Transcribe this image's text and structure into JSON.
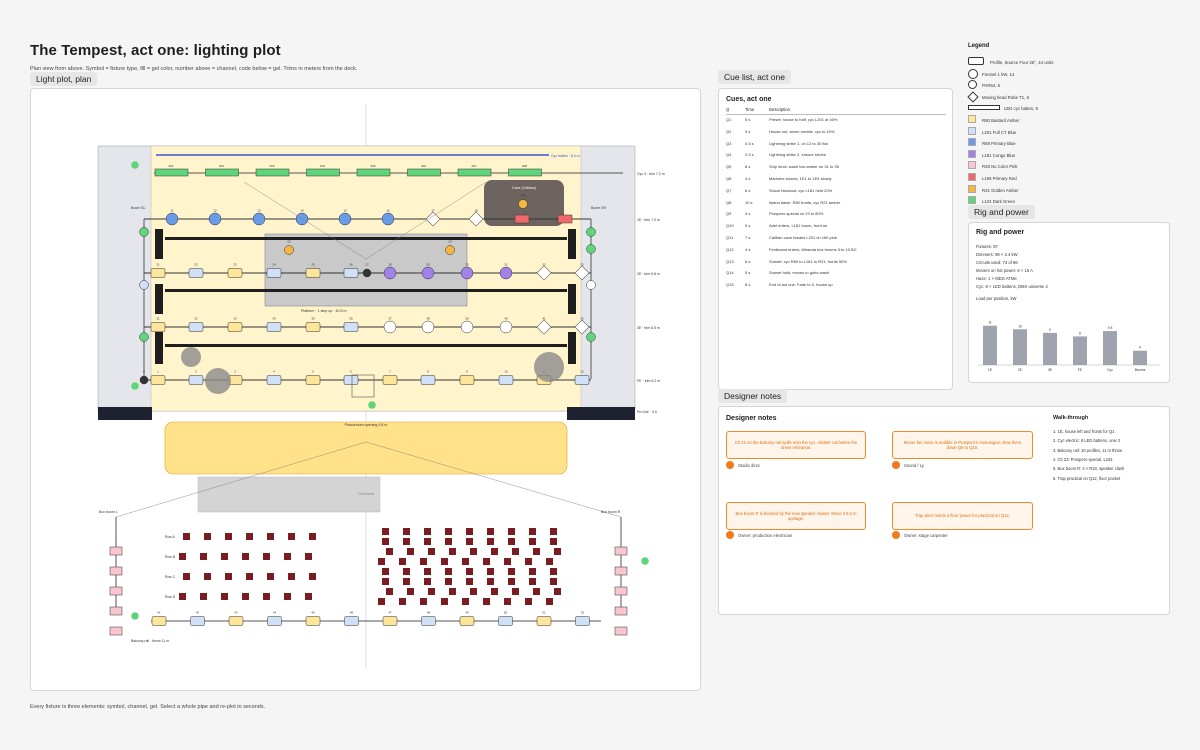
{
  "page": {
    "title": "The Tempest, act one: lighting plot",
    "subtitle": "Plan view from above. Symbol = fixture type, fill = gel color, number above = channel, code below = gel. Trims in meters from the deck.",
    "footer": "Every fixture is three elements: symbol, channel, gel. Select a whole pipe and re-plot in seconds."
  },
  "plot": {
    "label": "Light plot, plan",
    "cyc_label": "Cyc 3 · trim 7.2 m",
    "cyc_strip_label": "Cyc batten · 8.4 m",
    "boom_left": "Boom SL",
    "boom_right": "Boom SR",
    "electrics": [
      "1E · trim 7.0 m",
      "2E · trim 6.8 m",
      "3E · trim 6.5 m",
      "FE · trim 6.2 m"
    ],
    "platform_label": "Platform · 1 step up · 40.5 m",
    "cave_label": "Cave (Caliban)",
    "proscenium_label": "Proscenium opening 9.8 m",
    "proscenium_right": "Pro line · 0.0",
    "apron_label": "Orchestra",
    "box_left": "Box boom L",
    "box_right": "Box boom R",
    "rows": [
      "Row A",
      "Row B",
      "Row C",
      "Row D"
    ],
    "balcony_label": "Balcony rail · throw 11 m",
    "gel_marks": "R80 · L201 · R69 · L181"
  },
  "cues": {
    "tab": "Cue list, act one",
    "heading": "Cues, act one",
    "columns": [
      "Q",
      "Time",
      "Description"
    ],
    "rows": [
      [
        "Q1",
        "5 s",
        "Preset: house to half, cyc L201 at 40%"
      ],
      [
        "Q2",
        "3 s",
        "House out, storm rumble, cyc to 10%"
      ],
      [
        "Q3",
        "0.5 s",
        "Lightning strike 1, ch 12 to 30 flat"
      ],
      [
        "Q4",
        "0.3 s",
        "Lightning strike 2, ensure strobe"
      ],
      [
        "Q5",
        "8 s",
        "Ship deck: wash low amber on 31 to 35"
      ],
      [
        "Q6",
        "4 s",
        "Mariners shouts, 1E1 to 1E4 slowly"
      ],
      [
        "Q7",
        "6 s",
        "Shock blackout, cyc L181 held 20%"
      ],
      [
        "Q8",
        "10 s",
        "Island dawn: R80 fronts, cyc R21 amber"
      ],
      [
        "Q9",
        "3 s",
        "Prospero special ch 23 to 80%"
      ],
      [
        "Q10",
        "5 s",
        "Ariel enters, L181 boom, front on"
      ],
      [
        "Q11",
        "7 s",
        "Caliban cave breaks L201 ch 160 pink"
      ],
      [
        "Q12",
        "4 s",
        "Ferdinand enters, Miranda box booms 3 to 10 BC"
      ],
      [
        "Q13",
        "6 s",
        "Sunset: cyc R80 to L181 to R21, fronts 50%"
      ],
      [
        "Q14",
        "5 s",
        "Sunset hold, moves to gobo wash"
      ],
      [
        "Q15",
        "8 s",
        "End of act one. Fade to 0, house up"
      ]
    ]
  },
  "legend": {
    "title": "Legend",
    "items": [
      {
        "label": "Profile, Source Four 26°, 44 units",
        "shape": "profile",
        "color": "#ffffff"
      },
      {
        "label": "Fresnel 1 kW, 14",
        "shape": "circle",
        "color": "#ffffff"
      },
      {
        "label": "PAR64, 6",
        "shape": "circle-small",
        "color": "#ffffff"
      },
      {
        "label": "Moving head Robe T1, 6",
        "shape": "diamond",
        "color": "#ffffff"
      },
      {
        "label": "LED cyc batten, 8",
        "shape": "batten",
        "color": "#ffffff"
      },
      {
        "label": "R80 Bastard Amber",
        "shape": "swatch",
        "color": "#fde59a"
      },
      {
        "label": "L201 Full CT Blue",
        "shape": "swatch",
        "color": "#cfe0f7"
      },
      {
        "label": "R69 Primary Blue",
        "shape": "swatch",
        "color": "#6a9be8"
      },
      {
        "label": "L181 Congo Blue",
        "shape": "swatch",
        "color": "#a182e8"
      },
      {
        "label": "R33 No Color Pink",
        "shape": "swatch",
        "color": "#f9c6cf"
      },
      {
        "label": "L106 Primary Red",
        "shape": "swatch",
        "color": "#f0696a"
      },
      {
        "label": "R21 Golden Amber",
        "shape": "swatch",
        "color": "#f7b63e"
      },
      {
        "label": "L124 Dark Green",
        "shape": "swatch",
        "color": "#5fd47a"
      }
    ]
  },
  "rig": {
    "tab": "Rig and power",
    "heading": "Rig and power",
    "lines": [
      "Fixtures: 87",
      "Dimmers: 96 × 2.4 kW",
      "Circuits used: 74 of 96",
      "Movers on hot power: 6 × 16 A",
      "Haze: 1 × MDG ATMe",
      "Cyc: 8 × LED battens, DMX universe 2"
    ],
    "chart_title": "Load per position, kW"
  },
  "chart_data": {
    "type": "bar",
    "title": "Load per position, kW",
    "categories": [
      "1E",
      "2E",
      "3E",
      "FE",
      "Cyc",
      "Booms"
    ],
    "values": [
      11,
      10,
      9,
      8,
      9.5,
      4
    ],
    "ylim": [
      0,
      14
    ]
  },
  "notes": {
    "tab": "Designer notes",
    "heading": "Designer notes",
    "cards": [
      {
        "text": "Ch 41 on the balcony rail spills onto the cyc, shutter cut before the dress rehearsal.",
        "author": "Studio direc"
      },
      {
        "text": "Mover fan noise is audible in Prospero's monologue; slow them down Q9 to Q10.",
        "author": "Sound / Ly"
      },
      {
        "text": "Box boom R is blocked by the new speaker cluster. Move it 0.5 m upstage.",
        "author": "Owner: production electrician"
      },
      {
        "text": "Trap door needs a floor power for practical on Q12.",
        "author": "Owner: stage carpenter"
      }
    ],
    "walk_title": "Walk-through",
    "walk": [
      "1. 1E, house left and fronts for Q1",
      "2. Cyc electric: 8 LED battens, univ 2",
      "3. Balcony rail: 10 profiles, 11 m throw",
      "4. Ch 23: Prospero special, L181",
      "5. Box boom R: 4 × R33, speaker clash",
      "6. Trap practical on Q12, floor pocket"
    ]
  },
  "colors": {
    "amber": "#fde59a",
    "ctblue": "#cfe0f7",
    "blue": "#6a9be8",
    "congo": "#a182e8",
    "pink": "#f9c6cf",
    "red": "#f0696a",
    "gold": "#f7b63e",
    "green": "#5fd47a",
    "accent": "#f07a1c"
  }
}
